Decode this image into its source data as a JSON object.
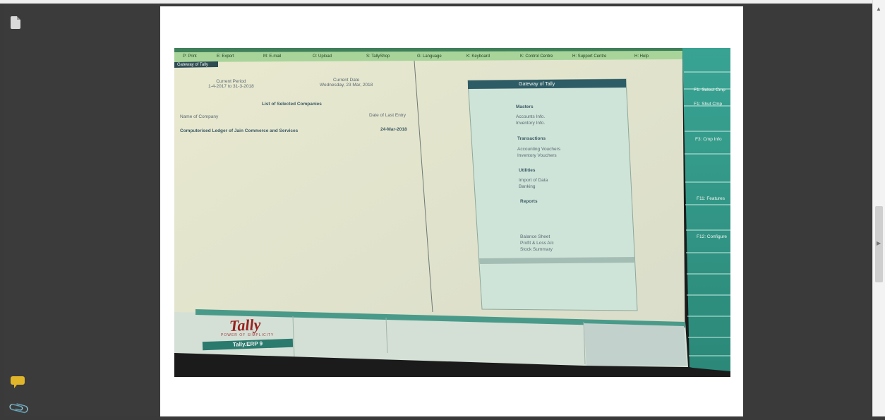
{
  "tally_screen": {
    "gateway": {
      "title": "Gateway of Tally",
      "sections": [
        {
          "heading": "Masters",
          "items": [
            "Accounts Info.",
            "Inventory Info."
          ]
        },
        {
          "heading": "Transactions",
          "items": [
            "Accounting Vouchers",
            "Inventory Vouchers"
          ]
        },
        {
          "heading": "Utilities",
          "items": [
            "Import of Data",
            "Banking"
          ]
        },
        {
          "heading": "Reports",
          "items": [
            "Balance Sheet",
            "Profit & Loss A/c",
            "Stock Summary"
          ]
        }
      ]
    },
    "sidebar": {
      "items": [
        "F1: Select Cmp",
        "F1: Shut Cmp",
        "F3: Cmp Info",
        "F11: Features",
        "F12: Configure"
      ]
    },
    "logo": {
      "text": "Tally",
      "version": "Tally.ERP 9"
    }
  }
}
